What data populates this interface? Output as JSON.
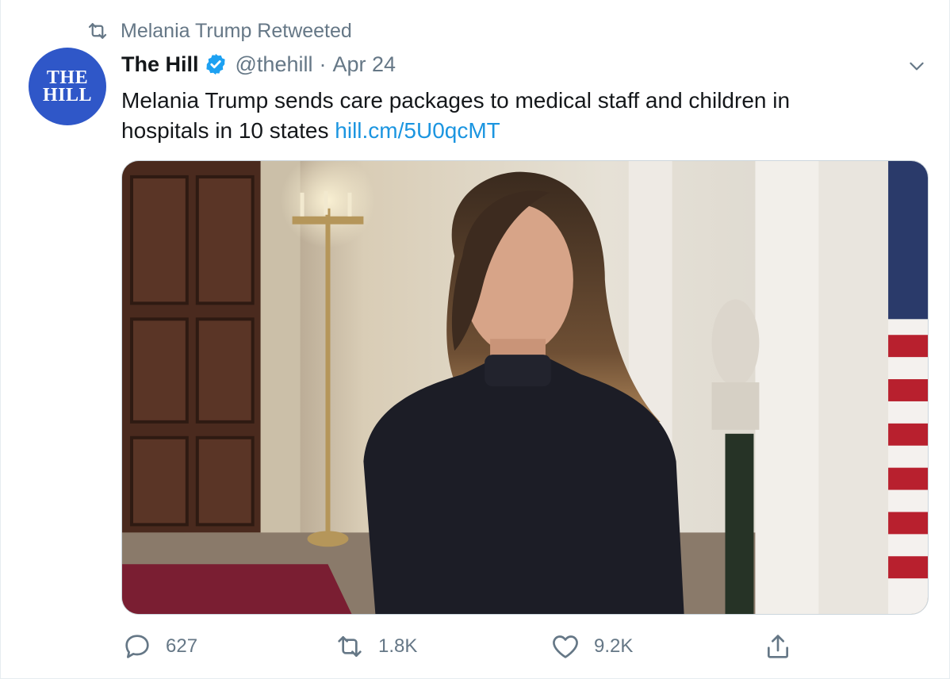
{
  "retweet_context": {
    "text": "Melania Trump Retweeted",
    "icon": "retweet-icon"
  },
  "author": {
    "avatar_line1": "THE",
    "avatar_line2": "HILL",
    "display_name": "The Hill",
    "verified_icon": "verified-badge-icon",
    "handle": "@thehill",
    "separator": "·",
    "date": "Apr 24"
  },
  "menu_icon": "chevron-down-icon",
  "tweet": {
    "text_line1": "Melania Trump sends care packages to medical staff and children in",
    "text_line2": "hospitals in 10 states ",
    "link": "hill.cm/5U0qcMT"
  },
  "media": {
    "type": "video-thumbnail"
  },
  "actions": {
    "reply": {
      "icon": "reply-icon",
      "count": "627"
    },
    "retweet": {
      "icon": "retweet-icon",
      "count": "1.8K"
    },
    "like": {
      "icon": "heart-icon",
      "count": "9.2K"
    },
    "share": {
      "icon": "share-icon"
    }
  },
  "colors": {
    "text": "#14171a",
    "muted": "#657786",
    "link": "#1b95e0",
    "verified": "#1da1f2",
    "avatar_bg": "#2f57c8"
  }
}
